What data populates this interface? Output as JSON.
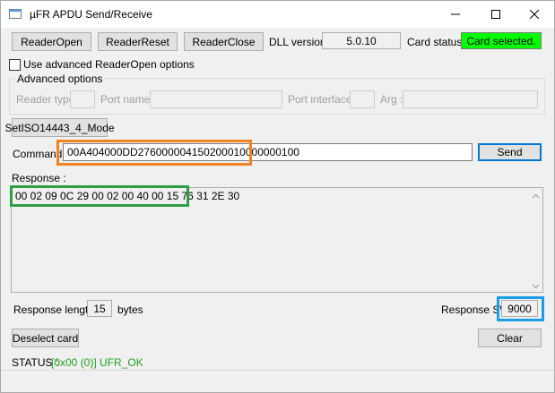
{
  "window": {
    "title": "µFR APDU Send/Receive",
    "icon": "app-window-icon",
    "controls": {
      "minimize": "minimize-icon",
      "maximize": "maximize-icon",
      "close": "close-icon"
    }
  },
  "toolbar": {
    "reader_open": "ReaderOpen",
    "reader_reset": "ReaderReset",
    "reader_close": "ReaderClose",
    "dll_version_label": "DLL version :",
    "dll_version_value": "5.0.10",
    "card_status_label": "Card status :",
    "card_status_value": "Card selected.",
    "card_status_color": "#00ff00"
  },
  "advanced": {
    "checkbox_label": "Use advanced ReaderOpen options",
    "checked": false,
    "group_title": "Advanced options",
    "reader_type_label": "Reader type :",
    "reader_type_value": "",
    "port_name_label": "Port name :",
    "port_name_value": "",
    "port_interface_label": "Port interface :",
    "port_interface_value": "",
    "arg_label": "Arg :",
    "arg_value": ""
  },
  "mode": {
    "button_label": "SetISO14443_4_Mode"
  },
  "command": {
    "label": "Command",
    "value": "00A404000DD2760000041502000100000001 00",
    "send_label": "Send"
  },
  "response": {
    "label": "Response :",
    "value": "00 02 09 0C 29 00 02 00 40 00 15 76 31 2E 30",
    "length_label": "Response length :",
    "length_value": "15",
    "length_unit": "bytes",
    "sw_label": "Response SW",
    "sw_value": "9000"
  },
  "actions": {
    "deselect_label": "Deselect card",
    "clear_label": "Clear"
  },
  "status": {
    "label": "STATUS :",
    "value": "[0x00 (0)] UFR_OK",
    "color": "#21a121"
  },
  "highlights": {
    "orange": "#f28220",
    "green": "#2ea043",
    "blue": "#1b9ee6"
  }
}
